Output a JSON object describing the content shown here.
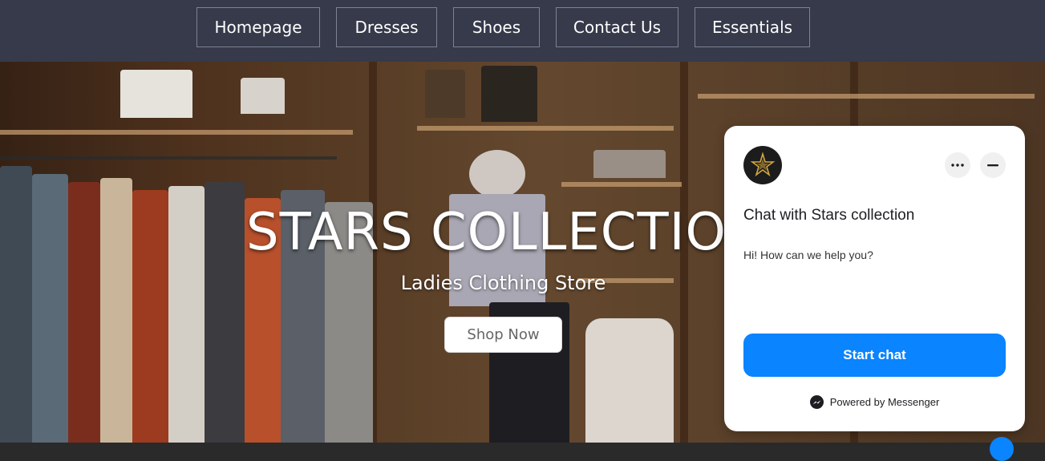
{
  "nav": {
    "items": [
      {
        "label": "Homepage"
      },
      {
        "label": "Dresses"
      },
      {
        "label": "Shoes"
      },
      {
        "label": "Contact Us"
      },
      {
        "label": "Essentials"
      }
    ]
  },
  "hero": {
    "title": "STARS COLLECTIO",
    "subtitle": "Ladies Clothing Store",
    "cta_label": "Shop Now"
  },
  "chat": {
    "avatar_icon": "star-logo-icon",
    "more_icon": "more-options-icon",
    "minimize_icon": "minimize-icon",
    "title": "Chat with Stars collection",
    "message": "Hi! How can we help you?",
    "start_label": "Start chat",
    "powered_label": "Powered by Messenger",
    "accent_color": "#0a84ff"
  }
}
